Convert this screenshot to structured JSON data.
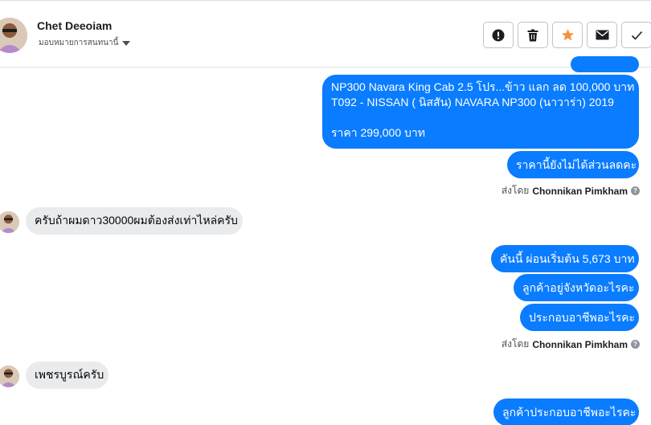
{
  "header": {
    "contact_name": "Chet Deeoiam",
    "assign_label": "มอบหมายการสนทนานี้",
    "actions": [
      "alert-icon",
      "trash-icon",
      "star-icon",
      "envelope-icon",
      "check-icon"
    ],
    "colors": {
      "star": "#f5923e",
      "accent": "#0a7cff"
    }
  },
  "messages": {
    "car_title": "NP300 Navara King Cab 2.5 โปร...ข้าว แลก ลด 100,000 บาท",
    "car_model": "T092 - NISSAN ( นิสสัน) NAVARA NP300 (นาวาร่า) 2019",
    "car_price": "ราคา 299,000 บาท",
    "price_note": "ราคานี้ยังไม่ได้ส่วนลดคะ",
    "sent_by_label": "ส่งโดย",
    "agent_name": "Chonnikan Pimkham",
    "customer_q1": "ครับถ้าผมดาว30000ผมต้องส่งเท่าไหล่ครับ",
    "installment": "คันนี้ ผ่อนเริ่มต้น 5,673 บาท",
    "ask_province": "ลูกค้าอยู่จังหวัดอะไรคะ",
    "ask_job": "ประกอบอาชีพอะไรคะ",
    "sent_by_label_2": "ส่งโดย",
    "agent_name_2": "Chonnikan Pimkham",
    "customer_a1": "เพชรบูรณ์ครับ",
    "ask_job_2": "ลูกค้าประกอบอาชีพอะไรคะ"
  }
}
